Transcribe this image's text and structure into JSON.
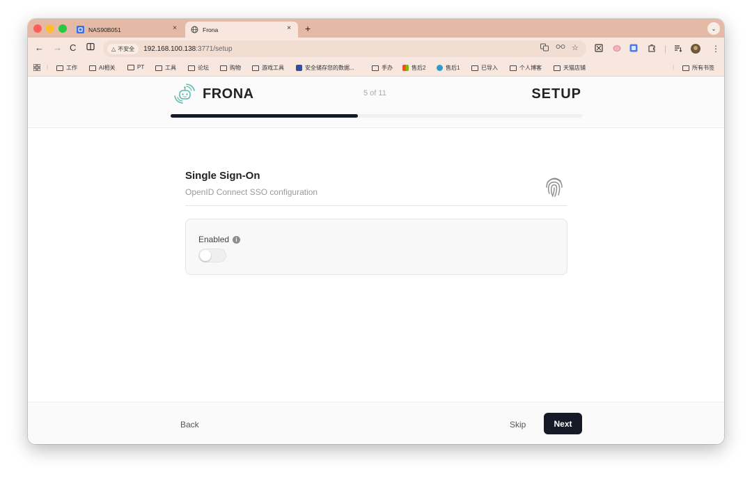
{
  "browser": {
    "tabs": [
      {
        "title": "NAS90B051",
        "active": false
      },
      {
        "title": "Frona",
        "active": true
      }
    ],
    "tab_close_glyph": "×",
    "new_tab_glyph": "+",
    "url": {
      "warning_label": "不安全",
      "host": "192.168.100.138",
      "path": ":3771/setup"
    },
    "bookmarks": [
      "工作",
      "AI相关",
      "PT",
      "工具",
      "论坛",
      "购物",
      "游戏工具",
      "安全储存您的数据...",
      "手办",
      "售后2",
      "售后1",
      "已导入",
      "个人博客",
      "天猫店铺"
    ],
    "all_bookmarks_label": "所有书签"
  },
  "header": {
    "brand": "FRONA",
    "step_text": "5 of 11",
    "title": "SETUP",
    "progress": 0.4545
  },
  "section": {
    "title": "Single Sign-On",
    "subtitle": "OpenID Connect SSO configuration"
  },
  "form": {
    "enabled_label": "Enabled",
    "enabled_value": false
  },
  "footer": {
    "back_label": "Back",
    "skip_label": "Skip",
    "next_label": "Next"
  },
  "colors": {
    "tabbar": "#e4b9a6",
    "toolbar": "#f8e7de",
    "primary_button": "#161a26",
    "logo_accent": "#5fb8b0"
  }
}
